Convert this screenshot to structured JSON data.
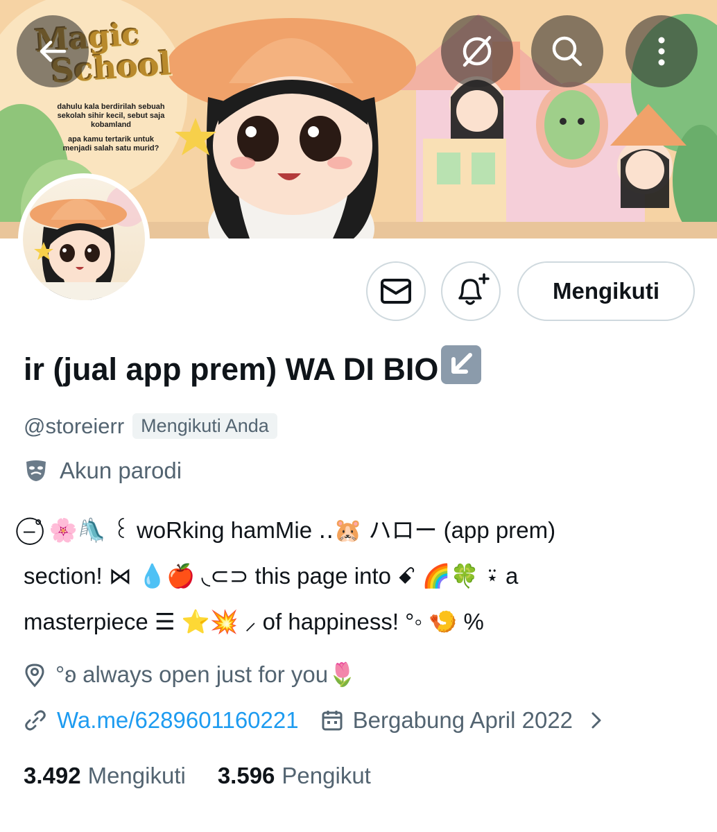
{
  "banner": {
    "title_line1": "Magic",
    "title_line2": "School",
    "caption_1": "dahulu kala berdirilah sebuah sekolah sihir kecil, sebut saja kobamland",
    "caption_2": "apa kamu tertarik untuk menjadi salah satu murid?"
  },
  "avatar": {
    "label": "Magic School"
  },
  "topbar": {
    "back_icon": "arrow-left-icon",
    "grok_icon": "slash-circle-icon",
    "search_icon": "search-icon",
    "more_icon": "more-vertical-icon"
  },
  "actions": {
    "message_icon": "envelope-icon",
    "notify_icon": "bell-plus-icon",
    "follow_label": "Mengikuti"
  },
  "profile": {
    "display_name": "ir (jual app prem) WA DI BIO",
    "name_emoji": "down-left-arrow-emoji",
    "handle": "@storeierr",
    "follows_you": "Mengikuti Anda",
    "parody_label": "Akun parodi",
    "bio_line1": "⎯⃝˚ 🌸🛝 ꒰ woRking hamMie ‥🐹 ハロー (app prem)",
    "bio_line2": "section! ⋈ 💧🍎 ◟⊂⊃ this page into ꗃ 🌈🍀 ⍣ a",
    "bio_line3": "masterpiece ☰ ⭐💥 ⸝ of happiness! °◦ 🍤 %",
    "location": "°ʚ always open just for you🌷",
    "website": "Wa.me/6289601160221",
    "joined": "Bergabung April 2022"
  },
  "stats": {
    "following_count": "3.492",
    "following_label": "Mengikuti",
    "followers_count": "3.596",
    "followers_label": "Pengikut"
  },
  "colors": {
    "accent": "#1d9bf0",
    "secondary_text": "#536471",
    "border": "#cfd9de"
  }
}
